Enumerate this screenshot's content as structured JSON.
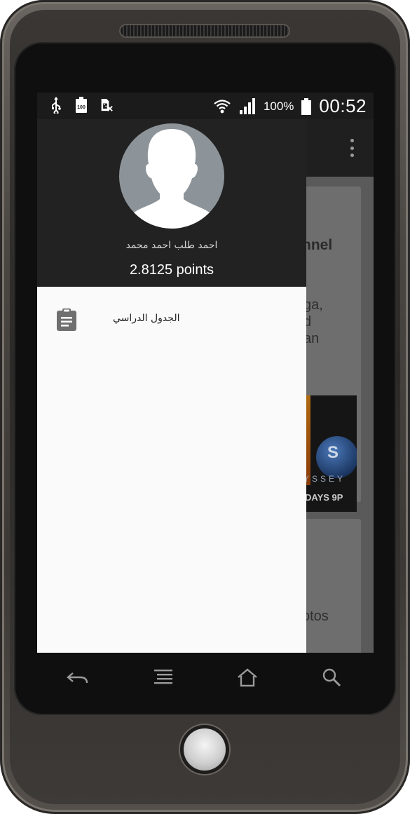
{
  "device": {
    "body_color": "#4a4642",
    "screen_bezel_color": "#0f0f0f"
  },
  "status_bar": {
    "left_icons": [
      "usb-icon",
      "battery-100-icon",
      "sim-missing-icon"
    ],
    "right_icons": [
      "wifi-icon",
      "signal-icon",
      "battery-icon"
    ],
    "battery_percent": "100%",
    "clock": "00:52"
  },
  "background_app": {
    "card_title_fragment": "nnel",
    "text_fragments": [
      "ga,",
      "d",
      "an"
    ],
    "image_text_planet": "S",
    "image_text_odyssey": "YSSEY",
    "image_text_days": "DAYS 9P",
    "second_card_fragment": "otos",
    "overflow_menu_icon": "more-vert-icon"
  },
  "drawer": {
    "header_bg": "#222222",
    "user_name": "احمد طلب احمد محمد",
    "points": "2.8125 points",
    "items": [
      {
        "label": "الجدول الدراسي",
        "icon": "clipboard-icon"
      }
    ]
  },
  "nav_bar": {
    "buttons": [
      "back-icon",
      "menu-icon",
      "home-icon",
      "search-icon"
    ]
  }
}
